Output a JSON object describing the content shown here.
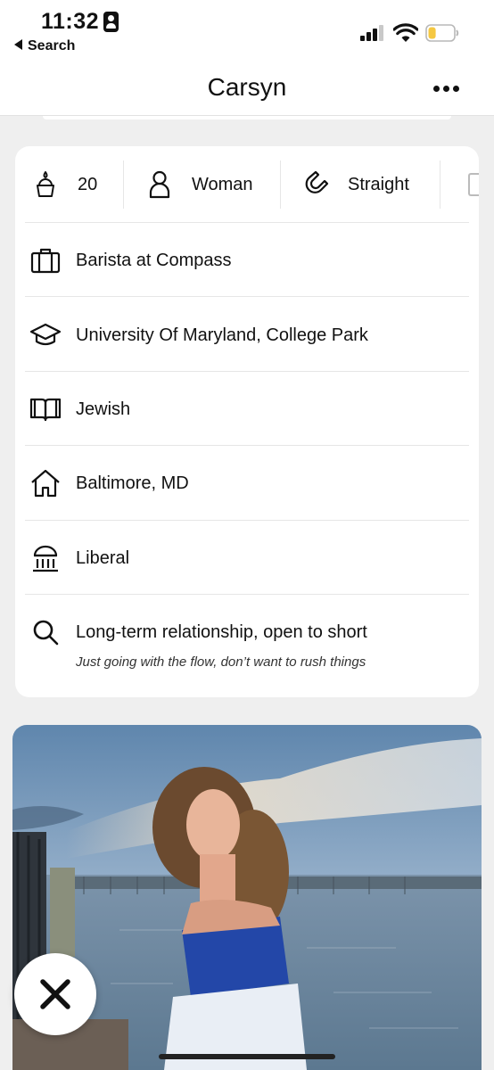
{
  "status_bar": {
    "time": "11:32",
    "back_label": "Search"
  },
  "header": {
    "title": "Carsyn"
  },
  "chips": [
    {
      "icon": "birthday-cake-icon",
      "label": "20"
    },
    {
      "icon": "person-icon",
      "label": "Woman"
    },
    {
      "icon": "orientation-magnet-icon",
      "label": "Straight"
    }
  ],
  "info_rows": [
    {
      "icon": "briefcase-icon",
      "label": "Barista at Compass"
    },
    {
      "icon": "graduation-cap-icon",
      "label": "University Of Maryland, College Park"
    },
    {
      "icon": "open-book-icon",
      "label": "Jewish"
    },
    {
      "icon": "house-icon",
      "label": "Baltimore, MD"
    },
    {
      "icon": "capitol-building-icon",
      "label": "Liberal"
    },
    {
      "icon": "search-icon",
      "label": "Long-term relationship, open to short",
      "sub_label": "Just going with the flow, don’t want to rush things"
    }
  ],
  "colors": {
    "background": "#efefef",
    "card": "#ffffff",
    "text": "#111111",
    "battery_fill": "#f5c842"
  },
  "battery_level": 0.3
}
